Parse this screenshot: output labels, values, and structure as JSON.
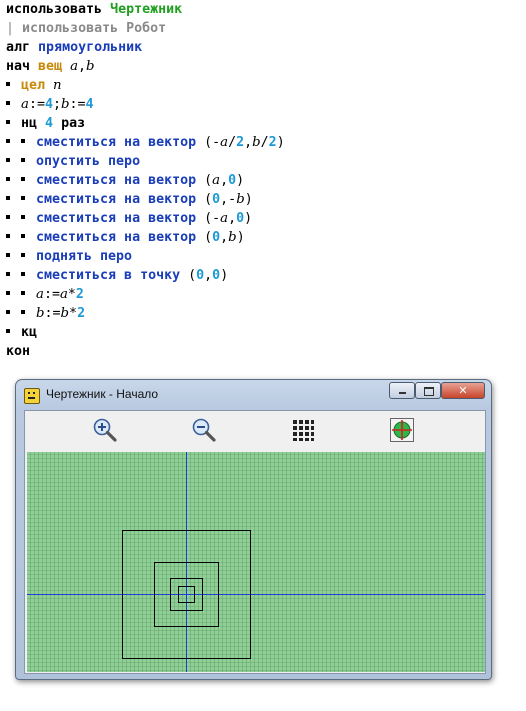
{
  "editor": {
    "line_uses1_kw": "использовать",
    "line_uses1_name": "Чертежник",
    "line_uses2_bar": "|",
    "line_uses2_kw": "использовать",
    "line_uses2_name": "Робот",
    "alg_kw": "алг",
    "alg_name": "прямоугольник",
    "nach_kw": "нач",
    "veshch": "вещ",
    "var_a": "a",
    "var_b": "b",
    "comma": ",",
    "cel": "цел",
    "var_n": "n",
    "assign": ":=",
    "num_4": "4",
    "semicolon": ";",
    "nc_kw": "нц",
    "raz_kw": "раз",
    "cmd_move_vec": "сместиться на вектор",
    "cmd_pen_down": "опустить перо",
    "cmd_pen_up": "поднять перо",
    "cmd_move_point": "сместиться в точку",
    "num_0": "0",
    "num_2": "2",
    "paren_open": "(",
    "paren_close": ")",
    "minus": "-",
    "slash": "/",
    "star": "*",
    "kc_kw": "кц",
    "kon_kw": "кон"
  },
  "window": {
    "title": "Чертежник - Начало",
    "close_glyph": "✕",
    "toolbar": {
      "zoom_in_icon": "zoom-in-icon",
      "zoom_out_icon": "zoom-out-icon",
      "grid_icon": "grid-icon",
      "fit_icon": "fit-view-icon"
    },
    "canvas": {
      "background": "#8fd095",
      "grid_color": "#6aa874",
      "axis_color": "#1f3bd9",
      "drawing_color": "#000000",
      "drawing": {
        "unit": "1 grid cell",
        "squares_half_size": [
          2,
          4,
          8,
          16
        ]
      }
    }
  }
}
